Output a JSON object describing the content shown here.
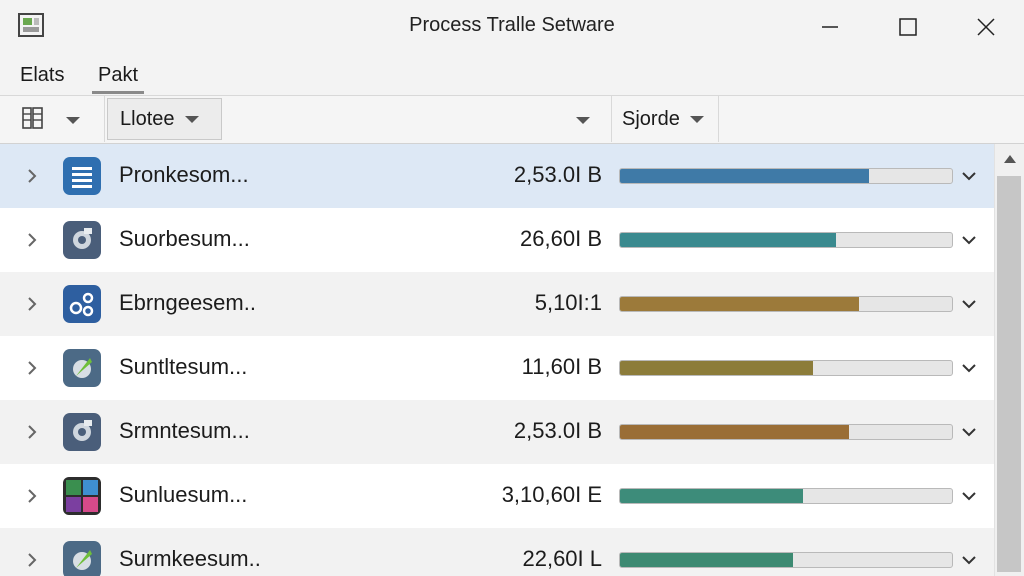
{
  "window": {
    "title": "Process Tralle Setware",
    "controls": [
      "minimize-icon",
      "maximize-icon",
      "close-icon"
    ]
  },
  "menu": {
    "items": [
      "Elats",
      "Pakt"
    ],
    "active_index": 1
  },
  "columns": {
    "view_icon": "columns-view-icon",
    "name_label": "Llotee",
    "sort_label": "Sjorde"
  },
  "rows": [
    {
      "name": "Pronkesom...",
      "size": "2,53.0I B",
      "icon": "list-app-icon",
      "progress": 0.75,
      "bar_color": "#3f7aa7",
      "selected": true
    },
    {
      "name": "Suorbesum...",
      "size": "26,60I B",
      "icon": "gear-app-icon",
      "progress": 0.65,
      "bar_color": "#3a8a8f",
      "selected": false
    },
    {
      "name": "Ebrngeesem..",
      "size": "5,10I:1",
      "icon": "network-app-icon",
      "progress": 0.72,
      "bar_color": "#9c7a3a",
      "selected": false
    },
    {
      "name": "Suntltesum...",
      "size": "11,60I B",
      "icon": "leaf-app-icon",
      "progress": 0.58,
      "bar_color": "#8c7c3a",
      "selected": false
    },
    {
      "name": "Srmntesum...",
      "size": "2,53.0I B",
      "icon": "gear-app-icon",
      "progress": 0.69,
      "bar_color": "#9a6e36",
      "selected": false
    },
    {
      "name": "Sunluesum...",
      "size": "3,10,60I E",
      "icon": "grid-app-icon",
      "progress": 0.55,
      "bar_color": "#3d8c7a",
      "selected": false
    },
    {
      "name": "Surmkeesum..",
      "size": "22,60I L",
      "icon": "leaf-app-icon",
      "progress": 0.52,
      "bar_color": "#3d8a72",
      "selected": false
    }
  ],
  "colors": {
    "selection": "#dde8f5",
    "row_alt": "#f2f2f2",
    "bar_track": "#e6e6e6"
  }
}
